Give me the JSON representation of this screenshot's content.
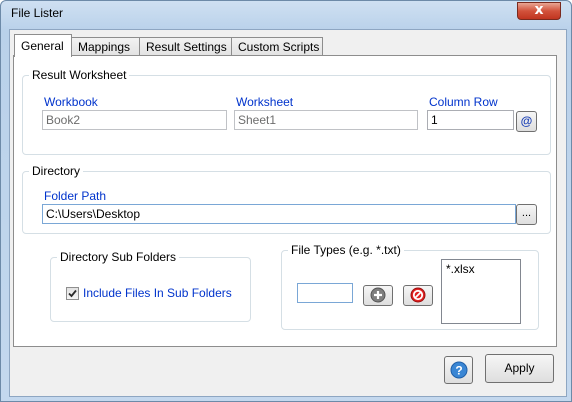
{
  "window": {
    "title": "File Lister",
    "close_glyph": "x"
  },
  "tabs": [
    "General",
    "Mappings",
    "Result Settings",
    "Custom Scripts"
  ],
  "result_worksheet": {
    "title": "Result Worksheet",
    "workbook_label": "Workbook",
    "workbook_value": "Book2",
    "worksheet_label": "Worksheet",
    "worksheet_value": "Sheet1",
    "column_row_label": "Column Row",
    "column_row_value": "1",
    "pick_glyph": "@"
  },
  "directory": {
    "title": "Directory",
    "folder_path_label": "Folder Path",
    "folder_path_value": "C:\\Users\\Desktop",
    "browse_label": "..."
  },
  "sub_folders": {
    "title": "Directory Sub Folders",
    "include_label": "Include Files In Sub Folders",
    "checked": true
  },
  "file_types": {
    "title": "File Types (e.g. *.txt)",
    "input_value": "",
    "list": [
      "*.xlsx"
    ]
  },
  "footer": {
    "help_glyph": "?",
    "apply_label": "Apply"
  },
  "icons": {
    "add": "plus-circle",
    "remove": "no-entry",
    "help": "question-circle"
  }
}
